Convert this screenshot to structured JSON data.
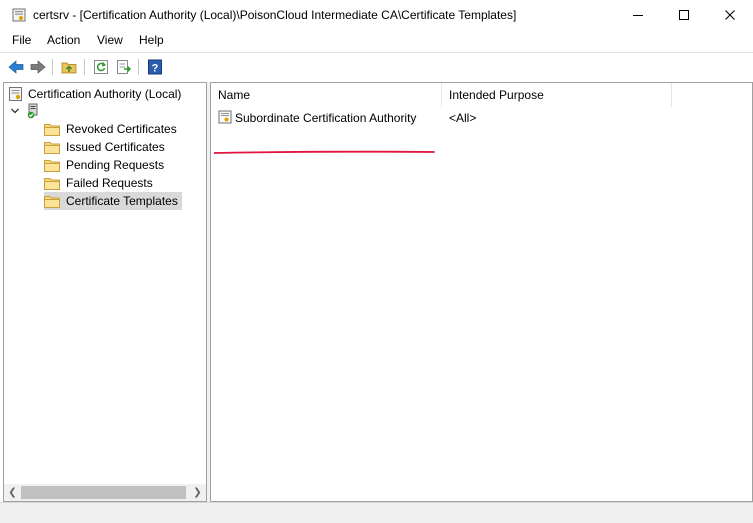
{
  "window": {
    "title": "certsrv - [Certification Authority (Local)\\PoisonCloud Intermediate CA\\Certificate Templates]"
  },
  "menu": {
    "items": [
      "File",
      "Action",
      "View",
      "Help"
    ]
  },
  "tree": {
    "root_label": "Certification Authority (Local)",
    "items": [
      {
        "label": "Revoked Certificates"
      },
      {
        "label": "Issued Certificates"
      },
      {
        "label": "Pending Requests"
      },
      {
        "label": "Failed Requests"
      },
      {
        "label": "Certificate Templates",
        "selected": true
      }
    ]
  },
  "list": {
    "columns": [
      "Name",
      "Intended Purpose"
    ],
    "rows": [
      {
        "name": "Subordinate Certification Authority",
        "purpose": "<All>"
      }
    ]
  },
  "colors": {
    "annotation_underline": "#e0143c",
    "selected_background": "#d9d9d9"
  }
}
